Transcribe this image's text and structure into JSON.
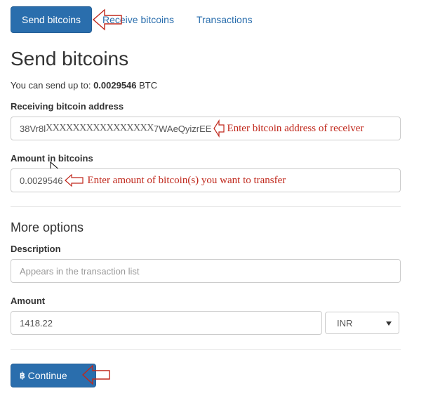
{
  "tabs": {
    "send": "Send bitcoins",
    "receive": "Receive bitcoins",
    "transactions": "Transactions"
  },
  "page_title": "Send bitcoins",
  "limit": {
    "prefix": "You can send up to: ",
    "amount": "0.0029546",
    "unit": " BTC"
  },
  "address": {
    "label": "Receiving bitcoin address",
    "value_start": "38Vr8l ",
    "value_masked": "XXXXXXXXXXXXXXXX",
    "value_end": "7WAeQyizrEE",
    "annotation": "Enter bitcoin address of receiver"
  },
  "btc_amount": {
    "label": "Amount in bitcoins",
    "value": "0.0029546",
    "annotation": "Enter amount of bitcoin(s) you want to transfer"
  },
  "more_options": {
    "title": "More options",
    "description_label": "Description",
    "description_placeholder": "Appears in the transaction list",
    "amount_label": "Amount",
    "amount_value": "1418.22",
    "currency": "INR"
  },
  "continue_button": {
    "glyph": "฿",
    "label": "Continue"
  },
  "colors": {
    "primary": "#2a6ead",
    "annotation": "#c0281c"
  }
}
